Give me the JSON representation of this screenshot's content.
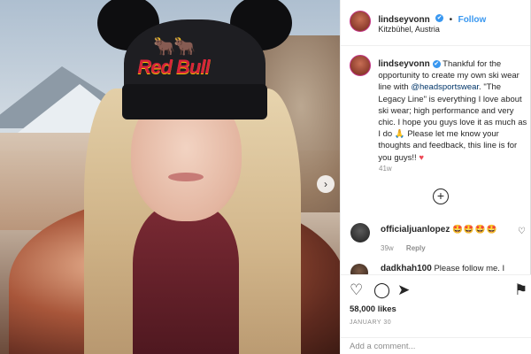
{
  "post": {
    "username": "lindseyvonn",
    "verified": "✔",
    "follow_label": "Follow",
    "dot": "•",
    "location": "Kitzbühel, Austria",
    "photo": {
      "hat_logo_text": "Red Bull",
      "next_icon": "chevron-right-icon"
    }
  },
  "caption": {
    "username": "lindseyvonn",
    "text_before": " Thankful for the opportunity to create my own ski wear line with ",
    "mention": "@headsportswear",
    "text_after": ". \"The Legacy Line\" is everything I love about ski wear; high performance and very chic. I hope you guys love it as much as I do 🙏 Please let me know your thoughts and feedback, this line is for you guys!! ",
    "heart": "♥",
    "time": "41w"
  },
  "load_more_icon": "+",
  "comments": [
    {
      "username": "officialjuanlopez",
      "text": "🤩🤩🤩🤩",
      "time": "39w",
      "reply_label": "Reply"
    },
    {
      "username": "dadkhah100",
      "text": "Please follow me. I"
    }
  ],
  "actions": {
    "like_icon": "♡",
    "comment_icon": "◯",
    "share_icon": "➤",
    "save_icon": "⚑",
    "comment_like_icon": "♡",
    "likes": "58,000 likes",
    "date": "JANUARY 30",
    "add_comment_placeholder": "Add a comment..."
  },
  "colors": {
    "accent": "#3897f0",
    "mention": "#003569",
    "text": "#262626",
    "muted": "#8e8e8e"
  }
}
